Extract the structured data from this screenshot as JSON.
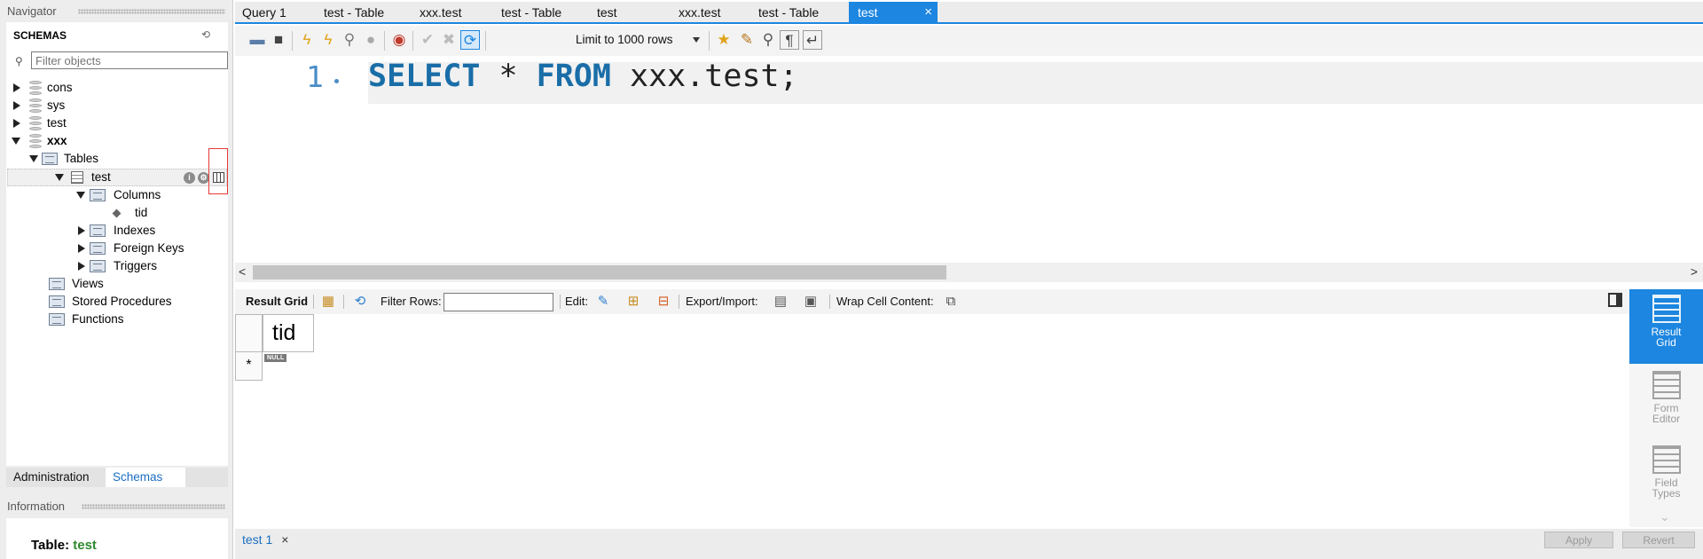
{
  "navigator": {
    "title": "Navigator",
    "schemas_header": "SCHEMAS",
    "filter_placeholder": "Filter objects",
    "tree": {
      "cons": "cons",
      "sys": "sys",
      "test": "test",
      "xxx": "xxx",
      "tables": "Tables",
      "table_test": "test",
      "columns": "Columns",
      "col_tid": "tid",
      "indexes": "Indexes",
      "foreign_keys": "Foreign Keys",
      "triggers": "Triggers",
      "views": "Views",
      "stored_procedures": "Stored Procedures",
      "functions": "Functions"
    },
    "bottom_tabs": {
      "administration": "Administration",
      "schemas": "Schemas"
    },
    "information_title": "Information",
    "info_table_label": "Table:",
    "info_table_value": "test"
  },
  "tabs": [
    {
      "label": "Query 1"
    },
    {
      "label": "test - Table"
    },
    {
      "label": "xxx.test"
    },
    {
      "label": "test - Table"
    },
    {
      "label": "test"
    },
    {
      "label": "xxx.test"
    },
    {
      "label": "test - Table"
    },
    {
      "label": "test",
      "close": "×"
    }
  ],
  "toolbar": {
    "limit_label": "Limit to 1000 rows"
  },
  "editor": {
    "line_number": "1",
    "sql": {
      "k1": "SELECT",
      "star": " * ",
      "k2": "FROM",
      "rest": " xxx.test;"
    }
  },
  "results_toolbar": {
    "result_grid": "Result Grid",
    "filter_rows": "Filter Rows:",
    "edit": "Edit:",
    "export_import": "Export/Import:",
    "wrap_cell_content": "Wrap Cell Content:"
  },
  "grid": {
    "column": "tid",
    "null_badge": "NULL",
    "row_marker": "*"
  },
  "right_panel": {
    "result_grid_1": "Result",
    "result_grid_2": "Grid",
    "form_editor_1": "Form",
    "form_editor_2": "Editor",
    "field_types_1": "Field",
    "field_types_2": "Types"
  },
  "status": {
    "result_tab": "test 1",
    "result_tab_close": "×",
    "apply": "Apply",
    "revert": "Revert"
  },
  "colors": {
    "accent": "#1c86e0",
    "keyword": "#1a6ea8",
    "info_value": "#2f8a2f",
    "highlight": "#e43a3a"
  }
}
